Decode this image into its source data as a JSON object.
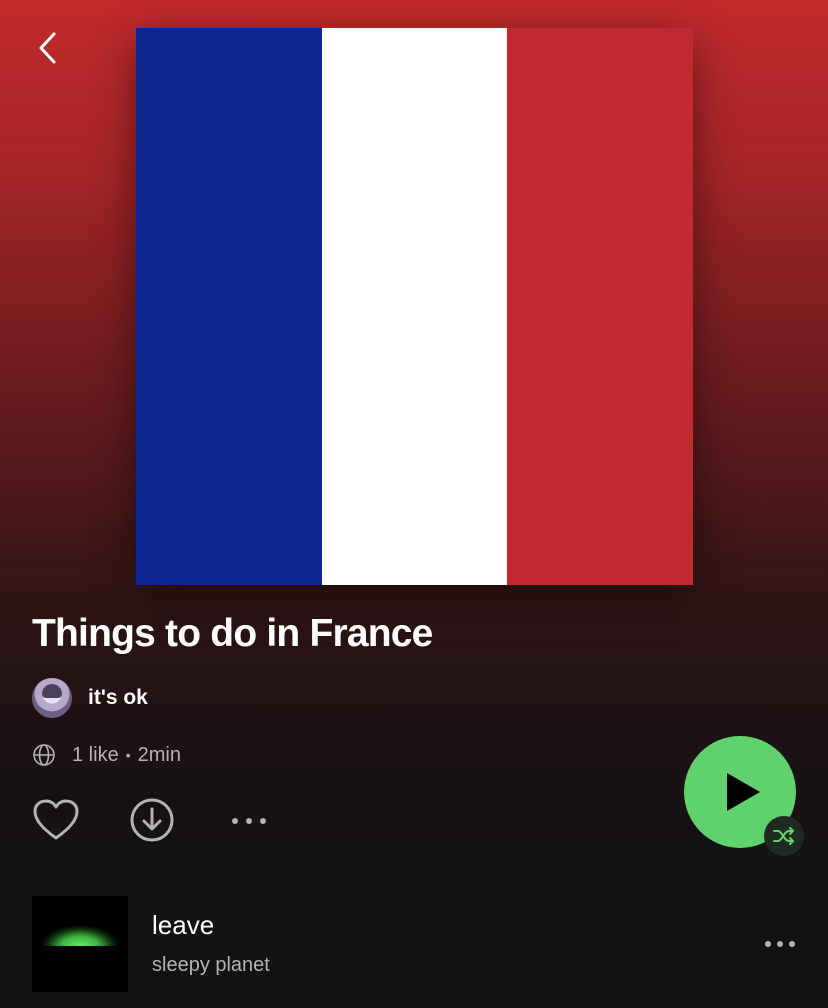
{
  "header": {
    "back_icon": "chevron-left-icon"
  },
  "cover": {
    "description_colors": {
      "blue": "#0d2591",
      "white": "#ffffff",
      "red": "#c0292f"
    }
  },
  "playlist": {
    "title": "Things to do in France",
    "owner": {
      "name": "it's ok",
      "avatar": "avatar-image"
    },
    "meta": {
      "visibility_icon": "globe-icon",
      "likes": "1 like",
      "separator": "•",
      "duration": "2min"
    }
  },
  "actions": {
    "like_icon": "heart-icon",
    "download_icon": "download-icon",
    "more_icon": "more-horizontal-icon",
    "play_icon": "play-icon",
    "shuffle_icon": "shuffle-icon"
  },
  "colors": {
    "accent": "#5fd16d",
    "text_secondary": "#b3b3b3",
    "background": "#121212"
  },
  "tracks": [
    {
      "title": "leave",
      "artist": "sleepy planet"
    }
  ]
}
